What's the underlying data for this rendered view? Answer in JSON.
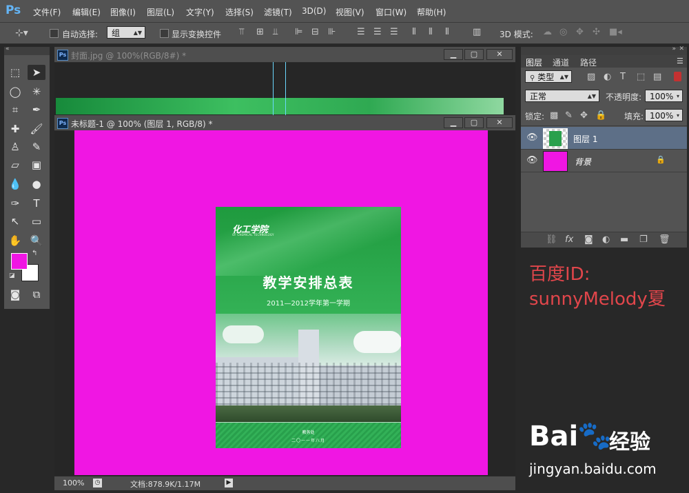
{
  "app": {
    "logo": "Ps"
  },
  "menu": [
    "文件(F)",
    "编辑(E)",
    "图像(I)",
    "图层(L)",
    "文字(Y)",
    "选择(S)",
    "滤镜(T)",
    "3D(D)",
    "视图(V)",
    "窗口(W)",
    "帮助(H)"
  ],
  "options": {
    "auto_select_label": "自动选择:",
    "auto_select_value": "组",
    "show_transform_label": "显示变换控件",
    "mode_3d_label": "3D 模式:"
  },
  "docs": {
    "cover_title": "封面.jpg @ 100%(RGB/8#) *",
    "untitled_title": "未标题-1 @ 100% (图层 1, RGB/8) *"
  },
  "cover": {
    "logo_text": "化工学院",
    "logo_sub": "OF CHEMICAL TECHNOLOGY",
    "heading": "教学安排总表",
    "term": "2011—2012学年第一学期",
    "dept": "教务处",
    "date": "二〇一一年八月"
  },
  "status": {
    "zoom": "100%",
    "doc_size": "文档:878.9K/1.17M"
  },
  "layers_panel": {
    "tabs": [
      "图层",
      "通道",
      "路径"
    ],
    "kind_label": "类型",
    "blend_mode": "正常",
    "opacity_label": "不透明度:",
    "opacity_value": "100%",
    "lock_label": "锁定:",
    "fill_label": "填充:",
    "fill_value": "100%",
    "layers": [
      {
        "name": "图层 1"
      },
      {
        "name": "背景"
      }
    ]
  },
  "watermark": {
    "line1": "百度ID:",
    "line2": "sunnyMelody夏"
  },
  "brand": {
    "baidu": "Bai",
    "jingyan": "经验",
    "url": "jingyan.baidu.com"
  },
  "colors": {
    "foreground": "#f016e3",
    "background": "#ffffff",
    "canvas": "#f016e3",
    "accent_green": "#2a9a4a"
  }
}
